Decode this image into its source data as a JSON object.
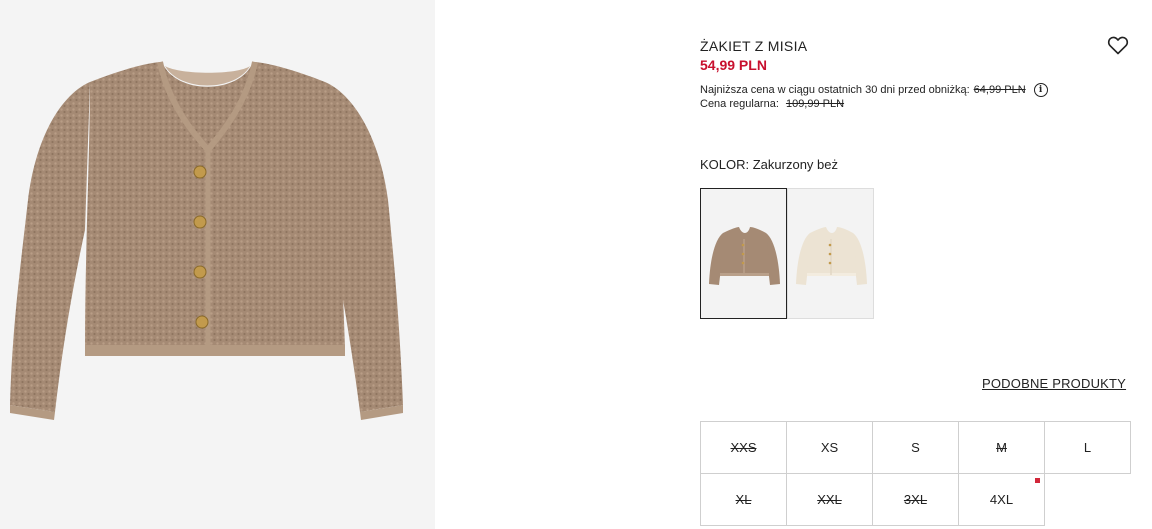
{
  "product": {
    "title": "ŻAKIET Z MISIA",
    "price": "54,99 PLN",
    "lowest_price_label": "Najniższa cena w ciągu ostatnich 30 dni przed obniżką:",
    "lowest_price": "64,99 PLN",
    "regular_price_label": "Cena regularna:",
    "regular_price": "109,99 PLN"
  },
  "color": {
    "label": "KOLOR: Zakurzony beż",
    "swatches": [
      {
        "name": "beige",
        "fill": "#a58a74",
        "selected": true
      },
      {
        "name": "cream",
        "fill": "#ece3d3",
        "selected": false
      }
    ]
  },
  "similar_link": "PODOBNE PRODUKTY",
  "sizes": [
    {
      "label": "XXS",
      "available": false
    },
    {
      "label": "XS",
      "available": true
    },
    {
      "label": "S",
      "available": true
    },
    {
      "label": "M",
      "available": false
    },
    {
      "label": "L",
      "available": true
    },
    {
      "label": "XL",
      "available": false
    },
    {
      "label": "XXL",
      "available": false
    },
    {
      "label": "3XL",
      "available": false
    },
    {
      "label": "4XL",
      "available": true,
      "low_stock": true
    }
  ],
  "icons": {
    "favorite": "heart-icon",
    "info": "info-icon"
  },
  "colors": {
    "price": "#c8102e",
    "low_stock": "#d2273a"
  }
}
